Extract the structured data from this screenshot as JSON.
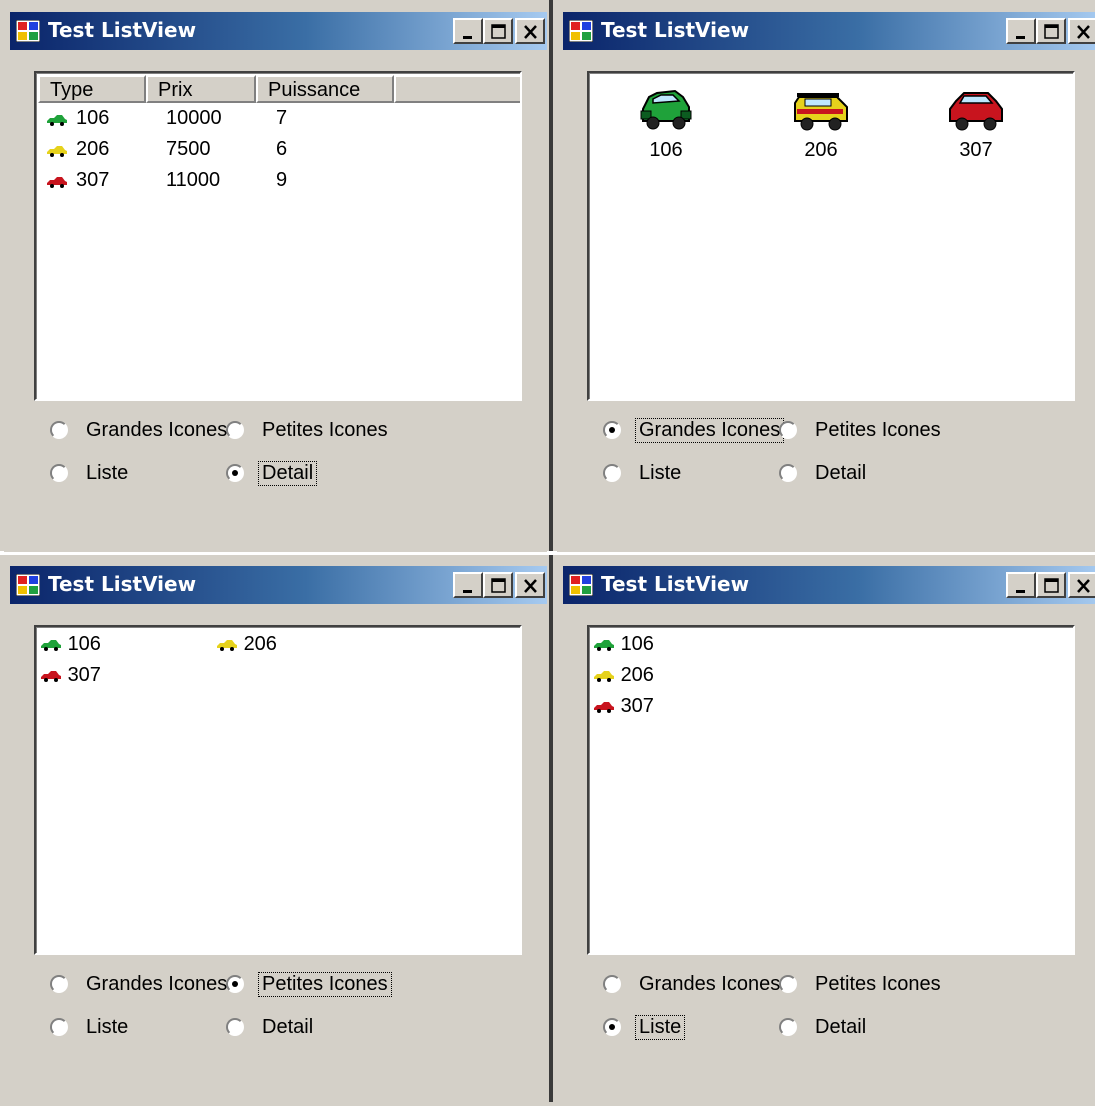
{
  "colors": {
    "titlebar_start": "#0a246a",
    "titlebar_end": "#a6caf0",
    "face": "#d4d0c8",
    "car_green": "#1fa23a",
    "car_yellow": "#e6d21c",
    "car_red": "#c8141e"
  },
  "windows": [
    {
      "title": "Test ListView",
      "view": "detail",
      "columns": [
        "Type",
        "Prix",
        "Puissance"
      ],
      "rows": [
        {
          "type": "106",
          "prix": "10000",
          "puissance": "7",
          "icon": "green-car-icon"
        },
        {
          "type": "206",
          "prix": "7500",
          "puissance": "6",
          "icon": "yellow-car-icon"
        },
        {
          "type": "307",
          "prix": "11000",
          "puissance": "9",
          "icon": "red-car-icon"
        }
      ],
      "radios": {
        "grandes": "Grandes Icones",
        "petites": "Petites Icones",
        "liste": "Liste",
        "detail": "Detail"
      },
      "selected": "detail"
    },
    {
      "title": "Test ListView",
      "view": "large-icons",
      "items": [
        "106",
        "206",
        "307"
      ],
      "radios": {
        "grandes": "Grandes Icones",
        "petites": "Petites Icones",
        "liste": "Liste",
        "detail": "Detail"
      },
      "selected": "grandes"
    },
    {
      "title": "Test ListView",
      "view": "small-icons",
      "items": [
        "106",
        "206",
        "307"
      ],
      "radios": {
        "grandes": "Grandes Icones",
        "petites": "Petites Icones",
        "liste": "Liste",
        "detail": "Detail"
      },
      "selected": "petites"
    },
    {
      "title": "Test ListView",
      "view": "list",
      "items": [
        "106",
        "206",
        "307"
      ],
      "radios": {
        "grandes": "Grandes Icones",
        "petites": "Petites Icones",
        "liste": "Liste",
        "detail": "Detail"
      },
      "selected": "liste"
    }
  ]
}
